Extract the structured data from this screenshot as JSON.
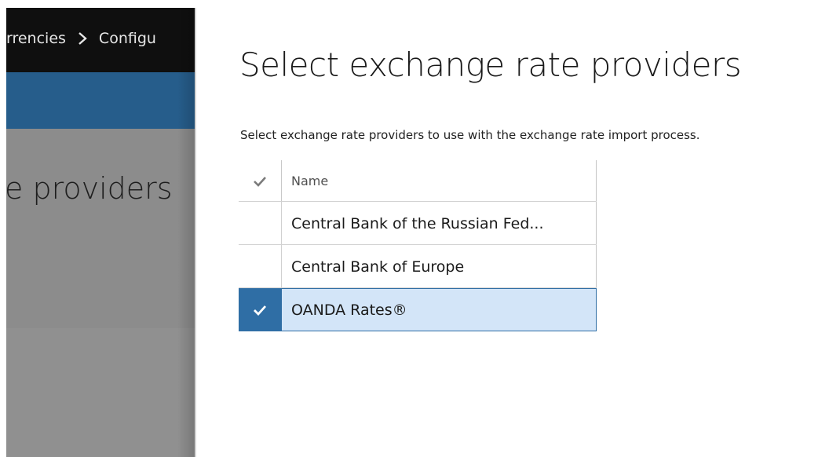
{
  "background_page": {
    "breadcrumb": [
      "rrencies",
      "Configu"
    ],
    "title": "e providers"
  },
  "dialog": {
    "title": "Select exchange rate providers",
    "description": "Select exchange rate providers to use with the exchange rate import process.",
    "grid": {
      "column_header": "Name",
      "rows": [
        {
          "name": "Central Bank of the Russian Fed...",
          "selected": false
        },
        {
          "name": "Central Bank of Europe",
          "selected": false
        },
        {
          "name": "OANDA Rates®",
          "selected": true
        }
      ]
    }
  },
  "colors": {
    "selection_accent": "#2f6ea5",
    "selection_row": "#d3e5f8",
    "nav_bar": "#0f0f0f",
    "app_bar": "#265d8b"
  },
  "icons": {
    "header_check": "checkmark-icon",
    "row_check": "checkmark-icon"
  }
}
